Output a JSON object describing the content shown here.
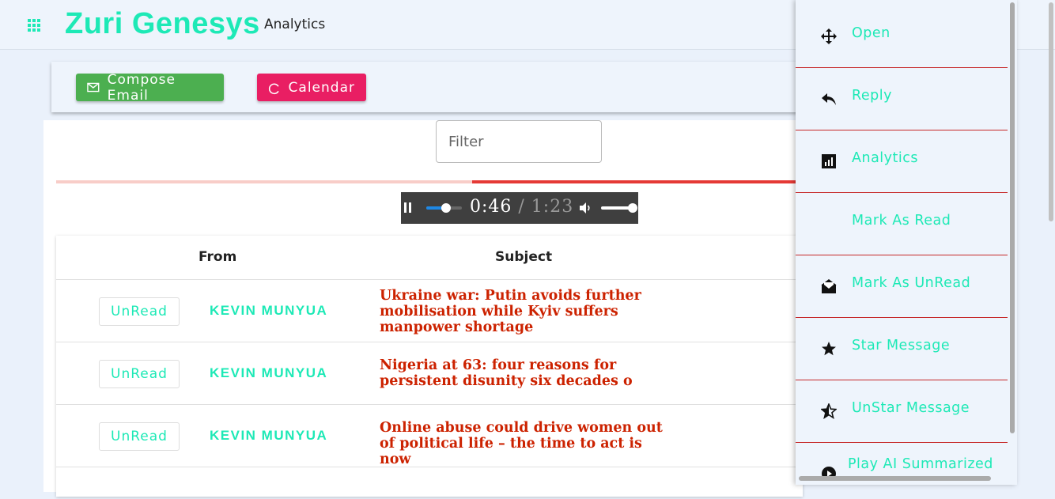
{
  "header": {
    "brand": "Zuri Genesys",
    "nav_label": "Analytics",
    "apps_icon": "apps-grid-icon"
  },
  "toolbar": {
    "compose_label": "Compose Email",
    "calendar_label": "Calendar",
    "compose_color": "#4caf50",
    "calendar_color": "#e91e63"
  },
  "filter": {
    "placeholder": "Filter"
  },
  "audio": {
    "current_time": "0:46",
    "duration": " / 1:23",
    "seek_fraction": 0.55,
    "volume_fraction": 1.0
  },
  "table": {
    "headers": {
      "from": "From",
      "subject": "Subject"
    },
    "rows": [
      {
        "status": "UnRead",
        "sender": "KEVIN MUNYUA",
        "subject": "Ukraine war: Putin avoids further mobilisation while Kyiv suffers manpower shortage"
      },
      {
        "status": "UnRead",
        "sender": "KEVIN MUNYUA",
        "subject": "Nigeria at 63: four reasons for persistent disunity six decades o"
      },
      {
        "status": "UnRead",
        "sender": "KEVIN MUNYUA",
        "subject": "Online abuse could drive women out of political life – the time to act is now"
      }
    ]
  },
  "context_menu": {
    "items": [
      {
        "label": "Open",
        "icon": "move-arrows-icon"
      },
      {
        "label": "Reply",
        "icon": "reply-icon"
      },
      {
        "label": "Analytics",
        "icon": "analytics-icon"
      },
      {
        "label": "Mark As Read",
        "icon": ""
      },
      {
        "label": "Mark As UnRead",
        "icon": "envelope-open-icon"
      },
      {
        "label": "Star Message",
        "icon": "star-icon"
      },
      {
        "label": "UnStar Message",
        "icon": "star-half-icon"
      },
      {
        "label": "Play AI Summarized",
        "icon": "play-icon"
      }
    ]
  },
  "colors": {
    "accent": "#1de9b6",
    "subject_red": "#cc2200",
    "divider_red": "#c62828"
  }
}
